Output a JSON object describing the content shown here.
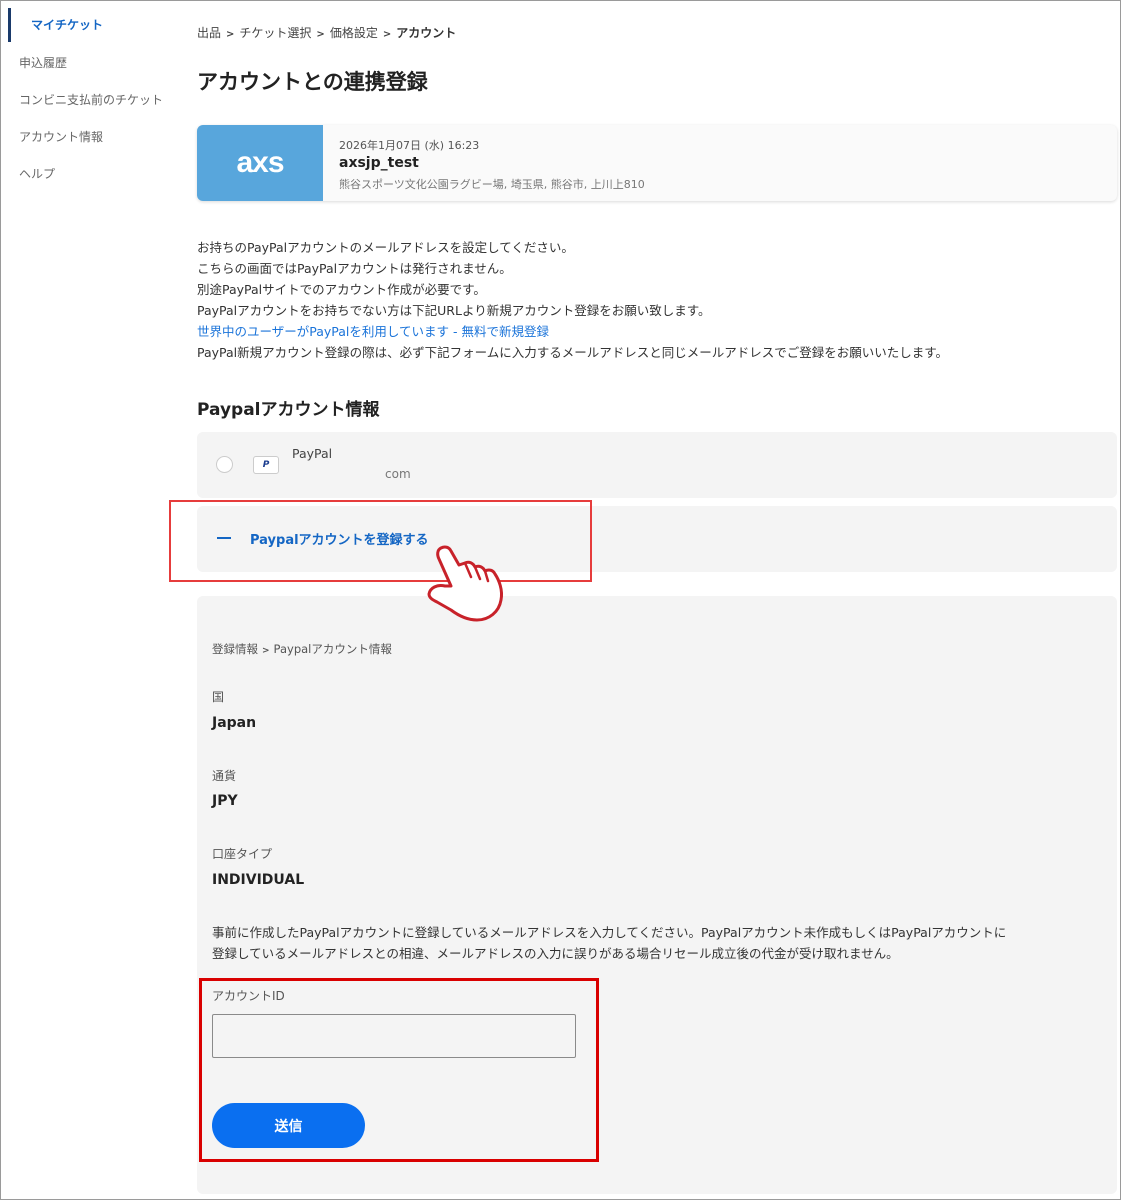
{
  "sidebar": {
    "items": [
      {
        "label": "マイチケット"
      },
      {
        "label": "申込履歴"
      },
      {
        "label": "コンビニ支払前のチケット"
      },
      {
        "label": "アカウント情報"
      },
      {
        "label": "ヘルプ"
      }
    ]
  },
  "breadcrumb": {
    "items": [
      "出品",
      "チケット選択",
      "価格設定"
    ],
    "current": "アカウント",
    "separator": ">"
  },
  "page_title": "アカウントとの連携登録",
  "event": {
    "logo_text": "axs",
    "datetime": "2026年1月07日 (水) 16:23",
    "name": "axsjp_test",
    "venue": "熊谷スポーツ文化公園ラグビー場, 埼玉県, 熊谷市, 上川上810"
  },
  "description": {
    "line1": "お持ちのPayPalアカウントのメールアドレスを設定してください。",
    "line2": "こちらの画面ではPayPalアカウントは発行されません。",
    "line3": "別途PayPalサイトでのアカウント作成が必要です。",
    "line4": "PayPalアカウントをお持ちでない方は下記URLより新規アカウント登録をお願い致します。",
    "link": "世界中のユーザーがPayPalを利用しています - 無料で新規登録",
    "line5": "PayPal新規アカウント登録の際は、必ず下記フォームに入力するメールアドレスと同じメールアドレスでご登録をお願いいたします。"
  },
  "paypal_section": {
    "title": "Paypalアカウント情報",
    "existing": {
      "logo_text": "P",
      "name": "PayPal",
      "email": "com"
    },
    "register_label": "Paypalアカウントを登録する"
  },
  "form": {
    "breadcrumb": [
      "登録情報",
      "Paypalアカウント情報"
    ],
    "breadcrumb_sep": ">",
    "country_label": "国",
    "country_value": "Japan",
    "currency_label": "通貨",
    "currency_value": "JPY",
    "account_type_label": "口座タイプ",
    "account_type_value": "INDIVIDUAL",
    "notice_line1": "事前に作成したPayPalアカウントに登録しているメールアドレスを入力してください。PayPalアカウント未作成もしくはPayPalアカウントに",
    "notice_line2": "登録しているメールアドレスとの相違、メールアドレスの入力に誤りがある場合リセール成立後の代金が受け取れません。",
    "account_id_label": "アカウントID",
    "account_id_value": "",
    "submit_label": "送信"
  },
  "colors": {
    "accent": "#1466c4",
    "button": "#0a6ff0",
    "axs_blue": "#58a6dc",
    "highlight_red": "#e63c3c"
  }
}
